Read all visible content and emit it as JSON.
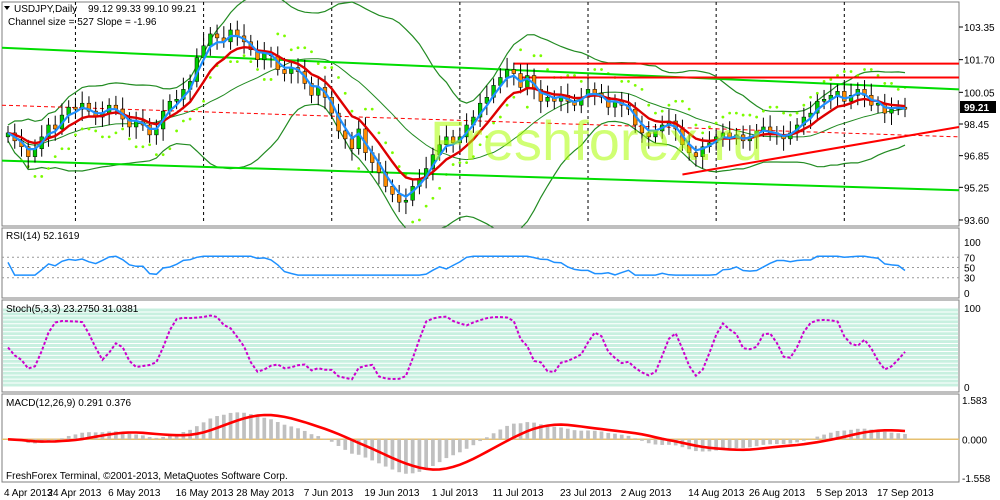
{
  "chart_data": {
    "type": "candlestick",
    "symbol_header": "USDJPY,Daily",
    "ohlc_header": "99.12 99.33 99.10 99.21",
    "channel_text": "Channel size = 527 Slope = -1.96",
    "current_price_label": "99.21",
    "watermark": "Freshforex.ru",
    "footer": "FreshForex Terminal, ©2001-2013, MetaQuotes Software Corp.",
    "price_axis": [
      103.35,
      101.7,
      100.05,
      98.45,
      96.85,
      95.25,
      93.6
    ],
    "date_labels": [
      "4 Apr 2013",
      "24 Apr 2013",
      "6 May 2013",
      "16 May 2013",
      "28 May 2013",
      "7 Jun 2013",
      "19 Jun 2013",
      "1 Jul 2013",
      "11 Jul 2013",
      "23 Jul 2013",
      "2 Aug 2013",
      "14 Aug 2013",
      "26 Aug 2013",
      "5 Sep 2013",
      "17 Sep 2013"
    ],
    "closes": [
      98.0,
      97.6,
      97.3,
      96.8,
      97.2,
      97.8,
      98.4,
      98.2,
      98.9,
      99.3,
      99.2,
      99.5,
      99.1,
      98.8,
      99.0,
      99.4,
      99.2,
      98.7,
      98.3,
      98.6,
      98.4,
      97.9,
      98.2,
      99.1,
      99.6,
      99.7,
      100.2,
      100.6,
      101.8,
      102.4,
      103.0,
      102.8,
      102.6,
      103.2,
      102.9,
      102.6,
      102.2,
      101.7,
      102.0,
      101.9,
      101.2,
      101.0,
      101.3,
      101.1,
      100.5,
      99.9,
      100.3,
      99.8,
      99.0,
      98.1,
      97.7,
      97.2,
      98.2,
      97.0,
      96.5,
      96.0,
      95.3,
      94.9,
      94.5,
      94.6,
      95.3,
      95.7,
      96.2,
      96.9,
      97.4,
      97.8,
      97.5,
      97.8,
      98.4,
      98.8,
      99.5,
      99.8,
      100.4,
      100.8,
      101.2,
      101.0,
      100.3,
      100.9,
      100.2,
      99.6,
      99.8,
      99.6,
      99.9,
      99.6,
      99.4,
      99.8,
      100.2,
      100.0,
      99.8,
      99.3,
      99.6,
      99.4,
      99.2,
      98.4,
      98.0,
      97.8,
      98.1,
      98.4,
      98.6,
      98.2,
      97.4,
      97.0,
      96.8,
      97.3,
      97.5,
      97.8,
      98.0,
      97.7,
      97.9,
      97.6,
      97.8,
      98.1,
      98.3,
      98.0,
      97.9,
      97.7,
      98.0,
      98.4,
      98.8,
      99.0,
      99.6,
      99.7,
      99.9,
      100.1,
      99.6,
      99.9,
      100.2,
      99.9,
      99.4,
      99.5,
      99.0,
      99.2,
      99.3,
      99.2
    ],
    "trendlines": {
      "channel_upper": {
        "color": "#00dd00",
        "from": 102.3,
        "to": 100.2
      },
      "channel_lower": {
        "color": "#00dd00",
        "from": 96.6,
        "to": 95.1
      },
      "resistance_1": {
        "color": "#ff0000",
        "level": 101.5
      },
      "resistance_2": {
        "color": "#ff0000",
        "level": 100.8
      },
      "support_rising": {
        "color": "#ff0000",
        "from": 95.9,
        "to": 98.3
      },
      "center_dashed": {
        "color": "#ff0000",
        "from": 99.4,
        "to": 97.8
      }
    },
    "indicators": {
      "rsi": {
        "label": "RSI(14) 52.1619",
        "axis": [
          100,
          70,
          50,
          30,
          0
        ],
        "color": "#1e90ff"
      },
      "stoch": {
        "label": "Stoch(5,3,3) 23.2750 31.0381",
        "axis": [
          100,
          0
        ],
        "color": "#cc00cc"
      },
      "macd": {
        "label": "MACD(12,26,9) 0.291 0.376",
        "axis": [
          1.583,
          0.0,
          -1.558
        ],
        "signal_color": "#ff0000",
        "hist_color": "#c0c0c0"
      }
    },
    "colors": {
      "bull_body": "#00cc00",
      "bear_body": "#ff8c00",
      "wick": "#000000",
      "ema_fast": "#1e90ff",
      "ema_slow": "#dd0000",
      "bollinger": "#228b22",
      "parabolic_sar": "#7cfc00",
      "panel_border": "#7f7f7f",
      "grid": "#000000",
      "stoch_fill": "#c8f0e0"
    }
  }
}
